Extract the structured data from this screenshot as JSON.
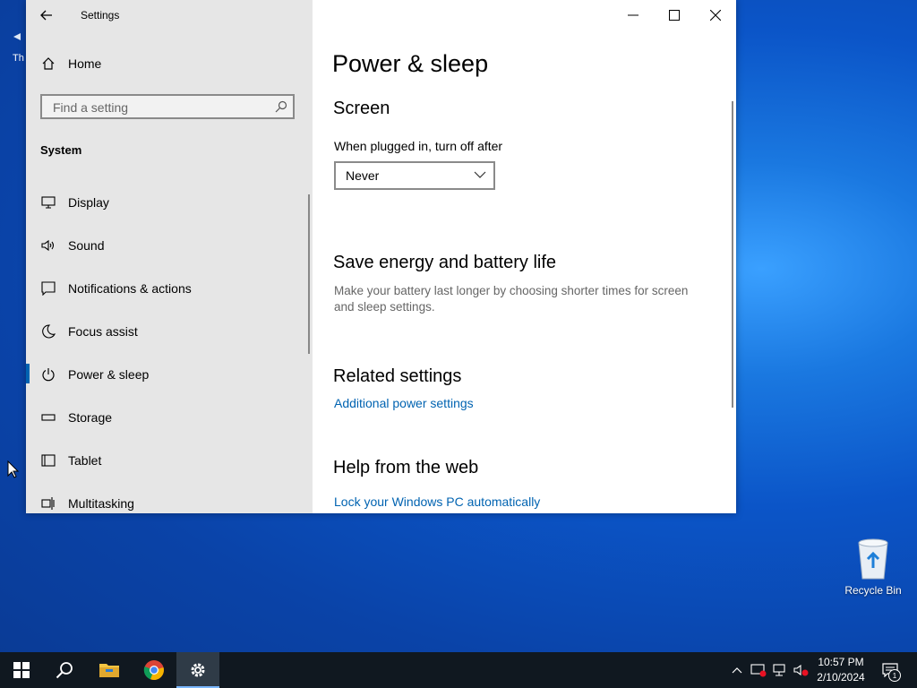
{
  "desktop": {
    "partial_icon_label": "Th",
    "recycle_bin_label": "Recycle Bin"
  },
  "window": {
    "title": "Settings",
    "nav": {
      "home_label": "Home",
      "search_placeholder": "Find a setting",
      "section_label": "System",
      "items": [
        {
          "label": "Display",
          "icon": "monitor-icon"
        },
        {
          "label": "Sound",
          "icon": "speaker-icon"
        },
        {
          "label": "Notifications & actions",
          "icon": "message-icon"
        },
        {
          "label": "Focus assist",
          "icon": "moon-icon"
        },
        {
          "label": "Power & sleep",
          "icon": "power-icon",
          "active": true
        },
        {
          "label": "Storage",
          "icon": "storage-icon"
        },
        {
          "label": "Tablet",
          "icon": "tablet-icon"
        },
        {
          "label": "Multitasking",
          "icon": "multitasking-icon"
        }
      ]
    },
    "main": {
      "page_title": "Power & sleep",
      "screen_heading": "Screen",
      "plugged_in_label": "When plugged in, turn off after",
      "plugged_in_value": "Never",
      "save_energy_heading": "Save energy and battery life",
      "save_energy_desc": "Make your battery last longer by choosing shorter times for screen and sleep settings.",
      "related_heading": "Related settings",
      "related_link": "Additional power settings",
      "help_heading": "Help from the web",
      "help_link": "Lock your Windows PC automatically"
    }
  },
  "taskbar": {
    "apps": [
      "start-icon",
      "search-icon",
      "file-explorer-icon",
      "chrome-icon",
      "settings-icon"
    ],
    "active_app": "settings-icon",
    "time": "10:57 PM",
    "date": "2/10/2024",
    "notification_count": "1"
  },
  "colors": {
    "accent": "#0063b1",
    "nav_bg": "#e6e6e6",
    "taskbar_bg": "#101820"
  }
}
